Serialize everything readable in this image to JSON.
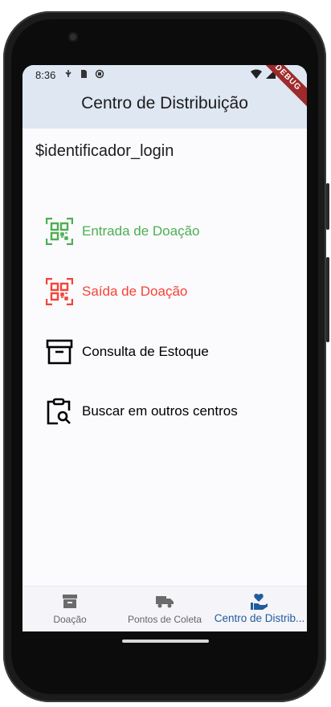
{
  "status_bar": {
    "time": "8:36"
  },
  "debug_banner": "DEBUG",
  "app_bar": {
    "title": "Centro de Distribuição"
  },
  "login": {
    "identifier": "$identificador_login"
  },
  "menu": [
    {
      "label": "Entrada de Doação",
      "icon": "qr-code-scan-icon",
      "color": "#4caf50"
    },
    {
      "label": "Saída de Doação",
      "icon": "qr-code-scan-icon",
      "color": "#f44336"
    },
    {
      "label": "Consulta de Estoque",
      "icon": "archive-box-icon",
      "color": "#000000"
    },
    {
      "label": "Buscar em outros centros",
      "icon": "clipboard-search-icon",
      "color": "#000000"
    }
  ],
  "bottom_nav": {
    "items": [
      {
        "label": "Doação",
        "icon": "archive-box-icon",
        "active": false
      },
      {
        "label": "Pontos de Coleta",
        "icon": "truck-icon",
        "active": false
      },
      {
        "label": "Centro de Distrib...",
        "icon": "hand-heart-icon",
        "active": true
      }
    ]
  },
  "colors": {
    "app_bar": "#dee7f2",
    "accent": "#1f5c9e",
    "entrada": "#4caf50",
    "saida": "#f44336"
  }
}
